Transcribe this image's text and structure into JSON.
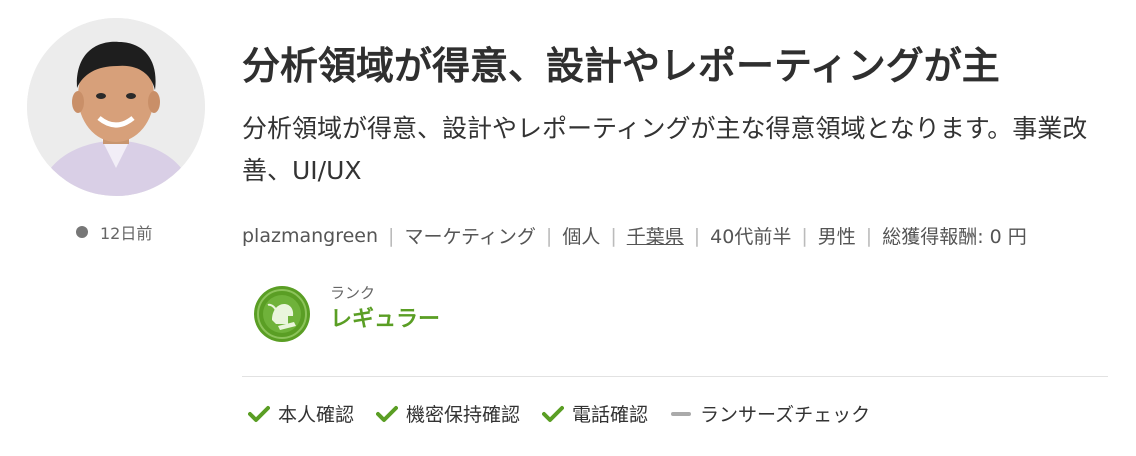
{
  "profile": {
    "last_seen": "12日前",
    "title": "分析領域が得意、設計やレポーティングが主",
    "description": "分析領域が得意、設計やレポーティングが主な得意領域となります。事業改善、UI/UX"
  },
  "meta": {
    "username": "plazmangreen",
    "occupation": "マーケティング",
    "type": "個人",
    "location": "千葉県",
    "age": "40代前半",
    "gender": "男性",
    "total_reward": "総獲得報酬: 0 円"
  },
  "rank": {
    "label": "ランク",
    "name": "レギュラー"
  },
  "verifications": [
    {
      "label": "本人確認",
      "status": "verified"
    },
    {
      "label": "機密保持確認",
      "status": "verified"
    },
    {
      "label": "電話確認",
      "status": "verified"
    },
    {
      "label": "ランサーズチェック",
      "status": "unverified"
    }
  ],
  "colors": {
    "accent_green": "#5a9e24",
    "unverified_gray": "#aaaaaa"
  }
}
